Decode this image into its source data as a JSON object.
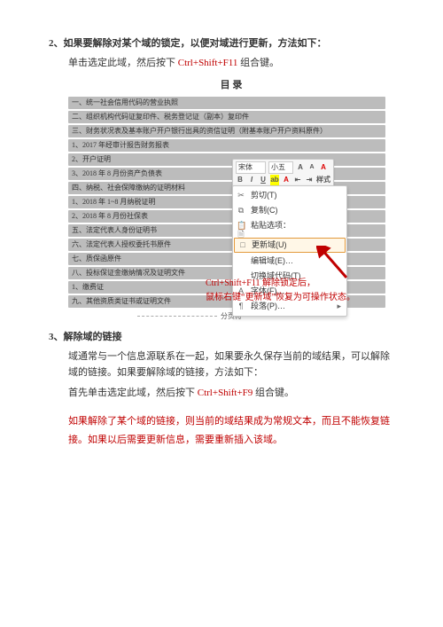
{
  "sec2": {
    "heading": "2、如果要解除对某个域的锁定，以便对域进行更新，方法如下：",
    "line": "单击选定此域，然后按下 ",
    "key": "Ctrl+Shift+F11",
    "line_tail": " 组合键。"
  },
  "screenshot": {
    "toc_title": "目  录",
    "toc": [
      "一、统一社会信用代码的营业执照",
      "二、组织机构代码证复印件、税务登记证（副本）复印件",
      "三、财务状况表及基本账户开户银行出具的资信证明（附基本账户开户资料原件）",
      "1、2017 年经审计报告财务报表",
      "2、开户证明",
      "3、2018 年 8 月份资产负债表",
      "四、纳税、社会保障缴纳的证明材料",
      "1、2018 年 1~8 月纳税证明",
      "2、2018 年 8 月份社保表",
      "五、法定代表人身份证明书",
      "六、法定代表人授权委托书原件",
      "七、质保函原件",
      "八、投标保证金缴纳情况及证明文件",
      "1、缴费证",
      "九、其他资质类证书或证明文件"
    ],
    "section_break": "分页符",
    "mini_toolbar": {
      "font_family": "宋体",
      "font_size": "小五",
      "btn_a_upper": "A",
      "btn_a_lower": "A",
      "btn_format": "A",
      "btn_bold": "B",
      "btn_italic": "I",
      "btn_underline": "U",
      "btn_highlight": "ab",
      "btn_color": "A",
      "btn_indent_dec": "⇤",
      "btn_indent_inc": "⇥",
      "btn_style": "样式"
    },
    "context_menu": {
      "cut": "剪切(T)",
      "copy": "复制(C)",
      "paste_label": "粘贴选项：",
      "update_field": "更新域(U)",
      "edit_field": "编辑域(E)…",
      "toggle_codes": "切换域代码(T)",
      "font": "字体(F)…",
      "paragraph": "段落(P)…"
    },
    "callout_line1_pre": "Ct",
    "callout_line1_mid": "rl+Shift+F11",
    "callout_line1_post": " 解除锁定后，",
    "callout_line2": "鼠标右键“更新域”恢复为可操作状态。"
  },
  "sec3": {
    "heading": "3、解除域的链接",
    "p1": "域通常与一个信息源联系在一起，如果要永久保存当前的域结果，可以解除域的链接。如果要解除域的链接，方法如下：",
    "p2_pre": "首先单击选定此域，然后按下 ",
    "p2_key": "Ctrl+Shift+F9",
    "p2_post": " 组合键。",
    "warn": "如果解除了某个域的链接，则当前的域结果成为常规文本，而且不能恢复链接。如果以后需要更新信息，需要重新插入该域。"
  }
}
